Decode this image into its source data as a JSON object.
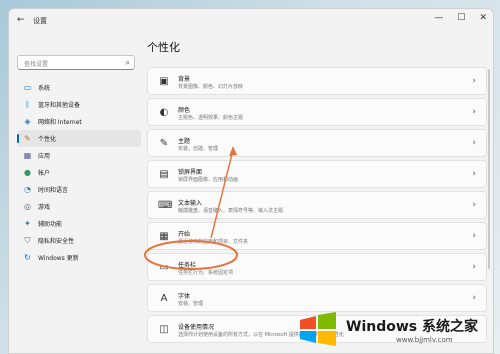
{
  "window": {
    "title": "设置",
    "back": "←",
    "minimize": "—",
    "maximize": "☐",
    "close": "✕"
  },
  "search": {
    "placeholder": "查找设置",
    "icon": "search-icon"
  },
  "sidebar": {
    "items": [
      {
        "label": "系统",
        "icon": "monitor-icon",
        "color": "#0078d4",
        "active": false
      },
      {
        "label": "蓝牙和其他设备",
        "icon": "bluetooth-icon",
        "color": "#0078d4",
        "active": false
      },
      {
        "label": "网络和 Internet",
        "icon": "wifi-icon",
        "color": "#2a7ab8",
        "active": false
      },
      {
        "label": "个性化",
        "icon": "brush-icon",
        "color": "#c0752a",
        "active": true
      },
      {
        "label": "应用",
        "icon": "apps-icon",
        "color": "#5a5a9a",
        "active": false
      },
      {
        "label": "帐户",
        "icon": "account-icon",
        "color": "#2e9c5c",
        "active": false
      },
      {
        "label": "时间和语言",
        "icon": "globe-clock-icon",
        "color": "#2a7ab8",
        "active": false
      },
      {
        "label": "游戏",
        "icon": "gamepad-icon",
        "color": "#666666",
        "active": false
      },
      {
        "label": "辅助功能",
        "icon": "accessibility-icon",
        "color": "#2a7ab8",
        "active": false
      },
      {
        "label": "隐私和安全性",
        "icon": "shield-icon",
        "color": "#666666",
        "active": false
      },
      {
        "label": "Windows 更新",
        "icon": "update-icon",
        "color": "#0078d4",
        "active": false
      }
    ]
  },
  "page": {
    "title": "个性化"
  },
  "cards": [
    {
      "title": "背景",
      "sub": "背景图像、颜色、幻灯片放映",
      "icon": "image-icon"
    },
    {
      "title": "颜色",
      "sub": "主题色、透明效果、颜色主题",
      "icon": "palette-icon"
    },
    {
      "title": "主题",
      "sub": "安装、创建、管理",
      "icon": "brush-icon"
    },
    {
      "title": "锁屏界面",
      "sub": "锁屏界面图像、应用和动画",
      "icon": "lockscreen-icon"
    },
    {
      "title": "文本输入",
      "sub": "触摸键盘、语音键入、表情符号等、输入法主题",
      "icon": "keyboard-icon"
    },
    {
      "title": "开始",
      "sub": "最近使用的应用和项目、文件夹",
      "icon": "start-icon"
    },
    {
      "title": "任务栏",
      "sub": "任务栏行为、系统固定项",
      "icon": "taskbar-icon"
    },
    {
      "title": "字体",
      "sub": "安装、管理",
      "icon": "font-icon"
    },
    {
      "title": "设备使用情况",
      "sub": "选择你计划使用设备的所有方式，以在 Microsoft 提供的产品中获取个性化",
      "icon": "device-icon"
    }
  ],
  "chevron": "›",
  "annotation": {
    "color": "#e8733a",
    "target": "任务栏"
  },
  "watermark": {
    "brand": "Windows 系统之家",
    "url": "www.bjjmlv.com"
  }
}
